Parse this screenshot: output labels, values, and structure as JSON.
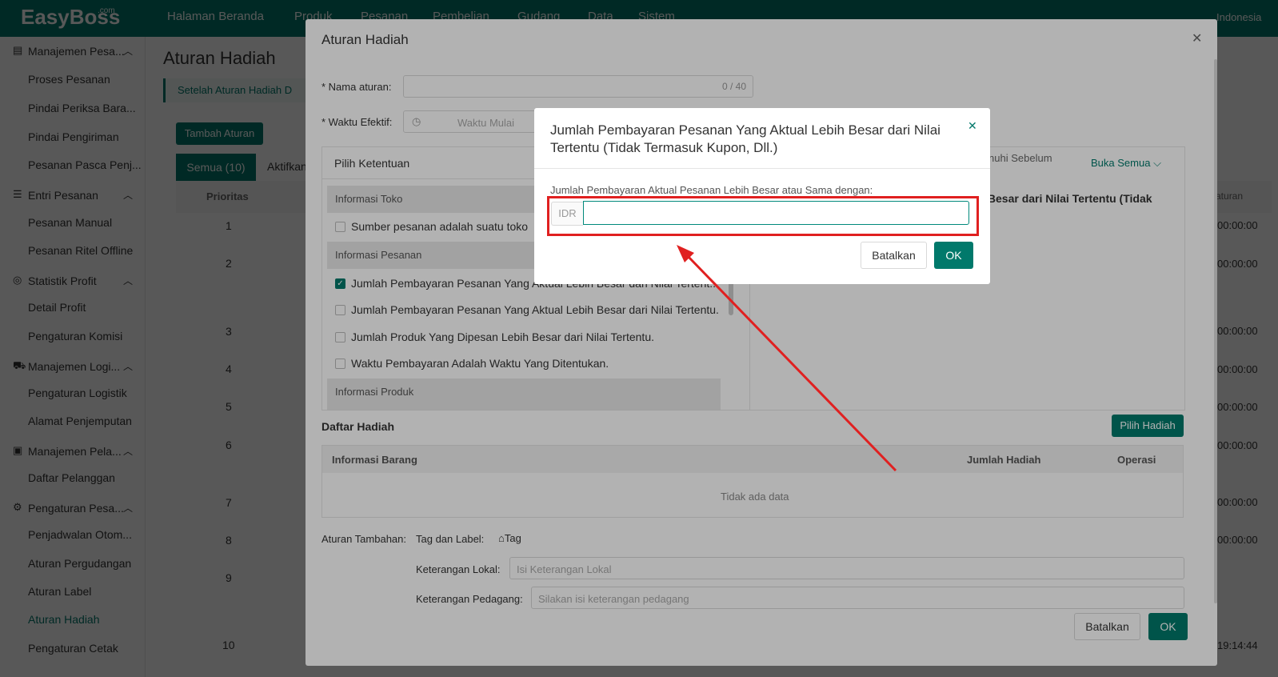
{
  "app": {
    "logo": "EasyBoss",
    "logo_suffix": ".com",
    "language": "Indonesia"
  },
  "nav": [
    "Halaman Beranda",
    "Produk",
    "Pesanan",
    "Pembelian",
    "Gudang",
    "Data",
    "Sistem"
  ],
  "sidebar": {
    "groups": [
      {
        "label": "Manajemen Pesa...",
        "items": [
          "Proses Pesanan",
          "Pindai Periksa Bara...",
          "Pindai Pengiriman",
          "Pesanan Pasca Penj..."
        ]
      },
      {
        "label": "Entri Pesanan",
        "items": [
          "Pesanan Manual",
          "Pesanan Ritel Offline"
        ]
      },
      {
        "label": "Statistik Profit",
        "items": [
          "Detail Profit",
          "Pengaturan Komisi"
        ]
      },
      {
        "label": "Manajemen Logi...",
        "items": [
          "Pengaturan Logistik",
          "Alamat Penjemputan"
        ]
      },
      {
        "label": "Manajemen Pela...",
        "items": [
          "Daftar Pelanggan"
        ]
      },
      {
        "label": "Pengaturan Pesa...",
        "items": [
          "Penjadwalan Otom...",
          "Aturan Pergudangan",
          "Aturan Label",
          "Aturan Hadiah",
          "Pengaturan Cetak"
        ]
      }
    ]
  },
  "page": {
    "title": "Aturan Hadiah",
    "notice": "Setelah Aturan Hadiah D",
    "add_button": "Tambah Aturan",
    "tabs": [
      "Semua (10)",
      "Aktifkan"
    ],
    "col_priority": "Prioritas",
    "rows": [
      "1",
      "2",
      "3",
      "4",
      "5",
      "6",
      "7",
      "8",
      "9",
      "10"
    ],
    "times": [
      "00:00:00",
      "00:00:00",
      "00:00:00",
      "00:00:00",
      "00:00:00",
      "00:00:00",
      "00:00:00",
      "00:00:00",
      "19:14:44"
    ],
    "right_header": "a aturan"
  },
  "modal": {
    "title": "Aturan Hadiah",
    "name_label": "* Nama aturan:",
    "name_counter": "0 / 40",
    "time_label": "* Waktu Efektif:",
    "time_placeholder": "Waktu Mulai",
    "pick_header": "Pilih Ketentuan",
    "sections": {
      "shop": "Informasi Toko",
      "order": "Informasi Pesanan",
      "product": "Informasi Produk"
    },
    "conditions": {
      "shop_source": "Sumber pesanan adalah suatu toko",
      "c1": "Jumlah Pembayaran Pesanan Yang Aktual Lebih Besar dari Nilai Tertent...",
      "c2": "Jumlah Pembayaran Pesanan Yang Aktual Lebih Besar dari Nilai Tertentu.",
      "c3": "Jumlah Produk Yang Dipesan Lebih Besar dari Nilai Tertentu.",
      "c4": "Waktu Pembayaran Adalah Waktu Yang Ditentukan."
    },
    "right_header_left": "erpenuhi Sebelum",
    "open_all": "Buka Semua",
    "right_bold": "bih Besar dari Nilai Tertentu (Tidak",
    "gift_list": "Daftar Hadiah",
    "pick_gift": "Pilih Hadiah",
    "table_headers": [
      "Informasi Barang",
      "Jumlah Hadiah",
      "Operasi"
    ],
    "no_data": "Tidak ada data",
    "extra_label": "Aturan Tambahan:",
    "tag_label": "Tag dan Label:",
    "tag_btn": "Tag",
    "local_label": "Keterangan Lokal:",
    "local_placeholder": "Isi Keterangan Lokal",
    "merchant_label": "Keterangan Pedagang:",
    "merchant_placeholder": "Silakan isi keterangan pedagang",
    "cancel": "Batalkan",
    "ok": "OK"
  },
  "dialog": {
    "title": "Jumlah Pembayaran Pesanan Yang Aktual Lebih Besar dari Nilai Tertentu (Tidak Termasuk Kupon, Dll.)",
    "field_label": "Jumlah Pembayaran Aktual Pesanan Lebih Besar atau Sama dengan:",
    "prefix": "IDR",
    "value": "",
    "cancel": "Batalkan",
    "ok": "OK"
  },
  "colors": {
    "primary": "#00796b",
    "annotation": "#e02020"
  }
}
